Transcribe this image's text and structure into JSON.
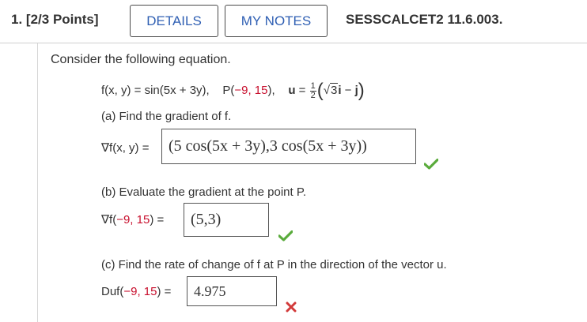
{
  "header": {
    "question_number": "1.",
    "points": "[2/3 Points]",
    "details_label": "DETAILS",
    "my_notes_label": "MY NOTES",
    "assignment_code": "SESSCALCET2 11.6.003."
  },
  "question": {
    "prompt": "Consider the following equation.",
    "function": "f(x, y) = sin(5x + 3y),",
    "point_label": "P(",
    "point_values": "−9, 15",
    "point_close": "),",
    "vector_u": "u",
    "vector_eq": " = ",
    "frac_num": "1",
    "frac_den": "2",
    "vector_sqrt_arg": "3",
    "vector_i": "i",
    "vector_minus": " − ",
    "vector_j": "j"
  },
  "parts": [
    {
      "label": "(a) Find the gradient of f.",
      "answer_label": "∇f(x, y) =",
      "answer": "(5 cos(5x + 3y),3 cos(5x + 3y))",
      "status": "correct"
    },
    {
      "label": "(b) Evaluate the gradient at the point P.",
      "answer_label_prefix": "∇f(",
      "answer_label_values": "−9, 15",
      "answer_label_suffix": ") =",
      "answer": "(5,3)",
      "status": "correct"
    },
    {
      "label": "(c) Find the rate of change of f at P in the direction of the vector u.",
      "answer_label_prefix": "Duf(",
      "answer_label_values": "−9, 15",
      "answer_label_suffix": ") =",
      "answer": "4.975",
      "status": "incorrect"
    }
  ],
  "colors": {
    "link_blue": "#2f5fb3",
    "red_value": "#c8102e",
    "check_green": "#5aab3c",
    "cross_red": "#d23a3a"
  },
  "icons": {
    "correct": "check-icon",
    "incorrect": "cross-icon"
  }
}
